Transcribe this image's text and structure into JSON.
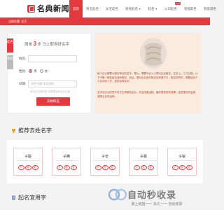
{
  "header": {
    "logo_text": "名典新闻",
    "nav": [
      {
        "label": "首页",
        "active": true
      },
      {
        "label": "男宝起名"
      },
      {
        "label": "女宝起名"
      },
      {
        "label": "易经起名",
        "caret": "▼"
      },
      {
        "label": "起名",
        "caret": "▼"
      },
      {
        "label": "公司起名",
        "tag": "new"
      },
      {
        "label": "智能取名"
      },
      {
        "label": "智能测名"
      }
    ]
  },
  "breadcrumb": {
    "home": "当前位置:",
    "current": "首页"
  },
  "form": {
    "tabs": [
      "起名",
      "测名"
    ],
    "header_pre": "简单",
    "header_num": "3",
    "header_post": "步 马上取得好名字",
    "surname_label": "姓氏:",
    "surname_placeholder": "",
    "gender_label": "性别:",
    "gender_male": "男",
    "gender_female": "女",
    "birth_label": "日期:",
    "birth_placeholder": "出生日期 年月日时",
    "hint": "若出生日期未知 可暂缓选择出生日期",
    "submit_label": "开始取名"
  },
  "info": {
    "para1": "每个企业都要以取好事业的名字，是以，需要专业人士帮对企业取名，名字上，三才五格，以下不是一般性起名者的取名，而且，要对企业进行取名如何做下手，取名的同时，需要结合个人名字的八字，宜的吉祥名字。",
    "para2": "名字对企业的意义在于生成新的企业，开启改善运程，最终得到好的效果，给您更好的运势，保障企业的运转。"
  },
  "sections": {
    "recommend_title": "推荐去姓名字",
    "naming_title": "起名宜用字"
  },
  "cards": [
    {
      "title": "子聪",
      "chips": [
        "子",
        "聪",
        "名"
      ]
    },
    {
      "title": "子腾",
      "chips": [
        "子",
        "腾",
        "名"
      ]
    },
    {
      "title": "子安",
      "chips": [
        "子",
        "安",
        "名"
      ]
    },
    {
      "title": "子晨",
      "chips": [
        "子",
        "晨",
        "名"
      ]
    },
    {
      "title": "子锐",
      "chips": [
        "子",
        "锐",
        "名"
      ]
    }
  ],
  "watermark": {
    "title": "自动秒收录",
    "subtitle": "做上链接一一 永久一一 自动收录"
  },
  "colors": {
    "accent": "#e4393c",
    "panel_bg": "#fbeade"
  }
}
